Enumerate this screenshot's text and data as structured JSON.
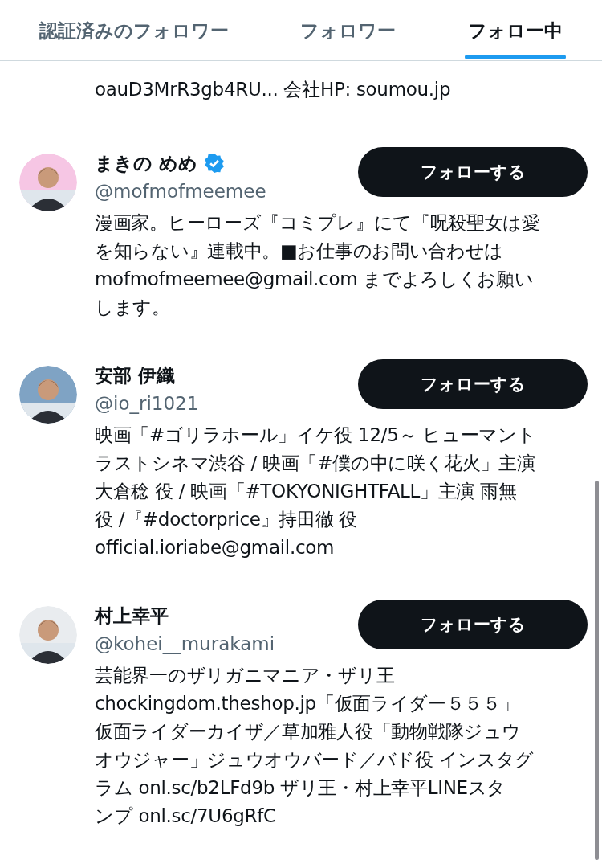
{
  "tabs": [
    {
      "label": "認証済みのフォロワー",
      "selected": false
    },
    {
      "label": "フォロワー",
      "selected": false
    },
    {
      "label": "フォロー中",
      "selected": true
    }
  ],
  "partial_bio": [
    "oauD3MrR3gb4RU... 会社HP: soumou.jp"
  ],
  "users": [
    {
      "name": "まきの めめ",
      "verified": true,
      "handle": "@mofmofmeemee",
      "button": "フォローする",
      "avatar": {
        "kind": "picture"
      },
      "bio": [
        "漫画家。ヒーローズ『コミプレ』にて『呪殺聖女は愛",
        "を知らない』連載中。■お仕事のお問い合わせは",
        "mofmofmeemee@gmail.com までよろしくお願い",
        "します。"
      ]
    },
    {
      "name": "安部 伊織",
      "verified": false,
      "handle": "@io_ri1021",
      "button": "フォローする",
      "avatar": {
        "kind": "picture"
      },
      "bio": [
        "映画「#ゴリラホール」イケ役 12/5～ ヒューマント",
        "ラストシネマ渋谷 / 映画「#僕の中に咲く花火」主演",
        "大倉稔 役 / 映画「#TOKYONIGHTFALL」主演 雨無",
        "役 /『#doctorprice』持田徹 役",
        "official.ioriabe@gmail.com"
      ]
    },
    {
      "name": "村上幸平",
      "verified": false,
      "handle": "@kohei__murakami",
      "button": "フォローする",
      "avatar": {
        "kind": "picture"
      },
      "bio": [
        "芸能界一のザリガニマニア・ザリ王",
        "chockingdom.theshop.jp「仮面ライダー５５５」",
        "仮面ライダーカイザ／草加雅人役「動物戦隊ジュウ",
        "オウジャー」ジュウオウバード／バド役 インスタグ",
        "ラム onl.sc/b2LFd9b ザリ王・村上幸平LINEスタ",
        "ンプ onl.sc/7U6gRfC"
      ]
    }
  ]
}
